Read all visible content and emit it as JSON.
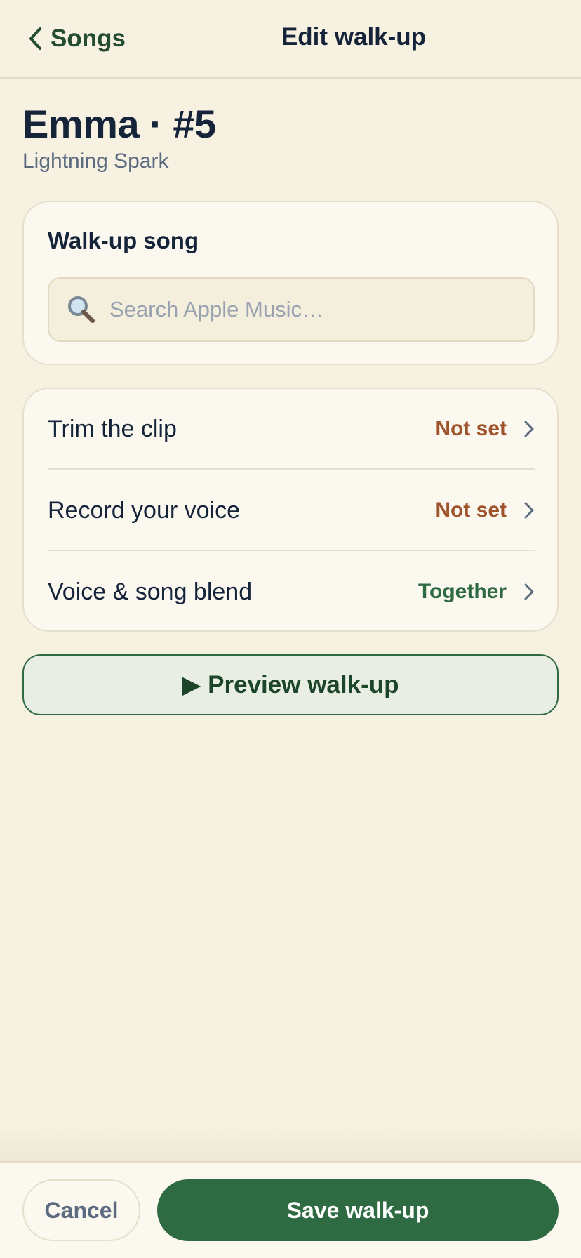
{
  "nav": {
    "back_label": "Songs",
    "title": "Edit walk-up"
  },
  "player": {
    "name": "Emma · #5",
    "team": "Lightning Spark"
  },
  "song_card": {
    "title": "Walk-up song",
    "search_placeholder": "Search Apple Music…",
    "search_value": ""
  },
  "options": [
    {
      "label": "Trim the clip",
      "value": "Not set",
      "value_color": "#a0542c"
    },
    {
      "label": "Record your voice",
      "value": "Not set",
      "value_color": "#a0542c"
    },
    {
      "label": "Voice & song blend",
      "value": "Together",
      "value_color": "#2f6a42"
    }
  ],
  "preview": {
    "icon": "play-icon",
    "label": "▶ Preview walk-up"
  },
  "footer": {
    "cancel_label": "Cancel",
    "save_label": "Save walk-up"
  },
  "icons": {
    "back": "chevron-left-icon",
    "search": "magnifier-icon",
    "row": "chevron-right-icon"
  },
  "colors": {
    "accent": "#2e6a42",
    "background": "#f6f1e1"
  }
}
